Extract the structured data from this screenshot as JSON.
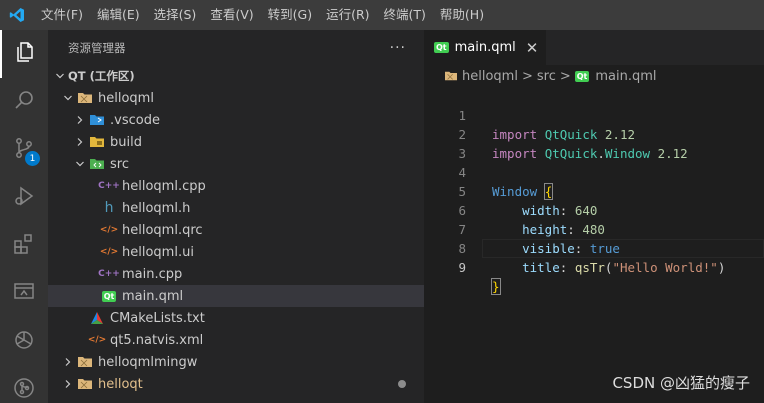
{
  "menu": [
    "文件(F)",
    "编辑(E)",
    "选择(S)",
    "查看(V)",
    "转到(G)",
    "运行(R)",
    "终端(T)",
    "帮助(H)"
  ],
  "activity": {
    "source_control_badge": "1"
  },
  "sidebar": {
    "title": "资源管理器",
    "more": "···",
    "workspace": "QT (工作区)",
    "items": [
      {
        "label": "helloqml"
      },
      {
        "label": ".vscode"
      },
      {
        "label": "build"
      },
      {
        "label": "src"
      },
      {
        "label": "helloqml.cpp"
      },
      {
        "label": "helloqml.h"
      },
      {
        "label": "helloqml.qrc"
      },
      {
        "label": "helloqml.ui"
      },
      {
        "label": "main.cpp"
      },
      {
        "label": "main.qml"
      },
      {
        "label": "CMakeLists.txt"
      },
      {
        "label": "qt5.natvis.xml"
      },
      {
        "label": "helloqmlmingw"
      },
      {
        "label": "helloqt"
      }
    ]
  },
  "icons": {
    "qt": "Qt",
    "cpp": "C++",
    "header": "h",
    "xml": "</>"
  },
  "editor": {
    "tab_label": "main.qml",
    "tab_close": "✕",
    "breadcrumb": [
      "helloqml",
      "src",
      "main.qml"
    ],
    "breadcrumb_sep": ">",
    "line_numbers": [
      "1",
      "2",
      "3",
      "4",
      "5",
      "6",
      "7",
      "8",
      "9"
    ],
    "code": {
      "l1_kw": "import",
      "l1_mod": "QtQuick",
      "l1_ver": "2.12",
      "l2_kw": "import",
      "l2_mod": "QtQuick",
      "l2_dot": ".",
      "l2_mod2": "Window",
      "l2_ver": "2.12",
      "l4_type": "Window",
      "l4_brace": "{",
      "l5_prop": "width",
      "l5_val": "640",
      "l6_prop": "height",
      "l6_val": "480",
      "l7_prop": "visible",
      "l7_val": "true",
      "l8_prop": "title",
      "l8_fn": "qsTr",
      "l8_str": "\"Hello World!\"",
      "l9_brace": "}",
      "colon": ":",
      "lparen": "(",
      "rparen": ")"
    }
  },
  "watermark": "CSDN @凶猛的瘦子"
}
